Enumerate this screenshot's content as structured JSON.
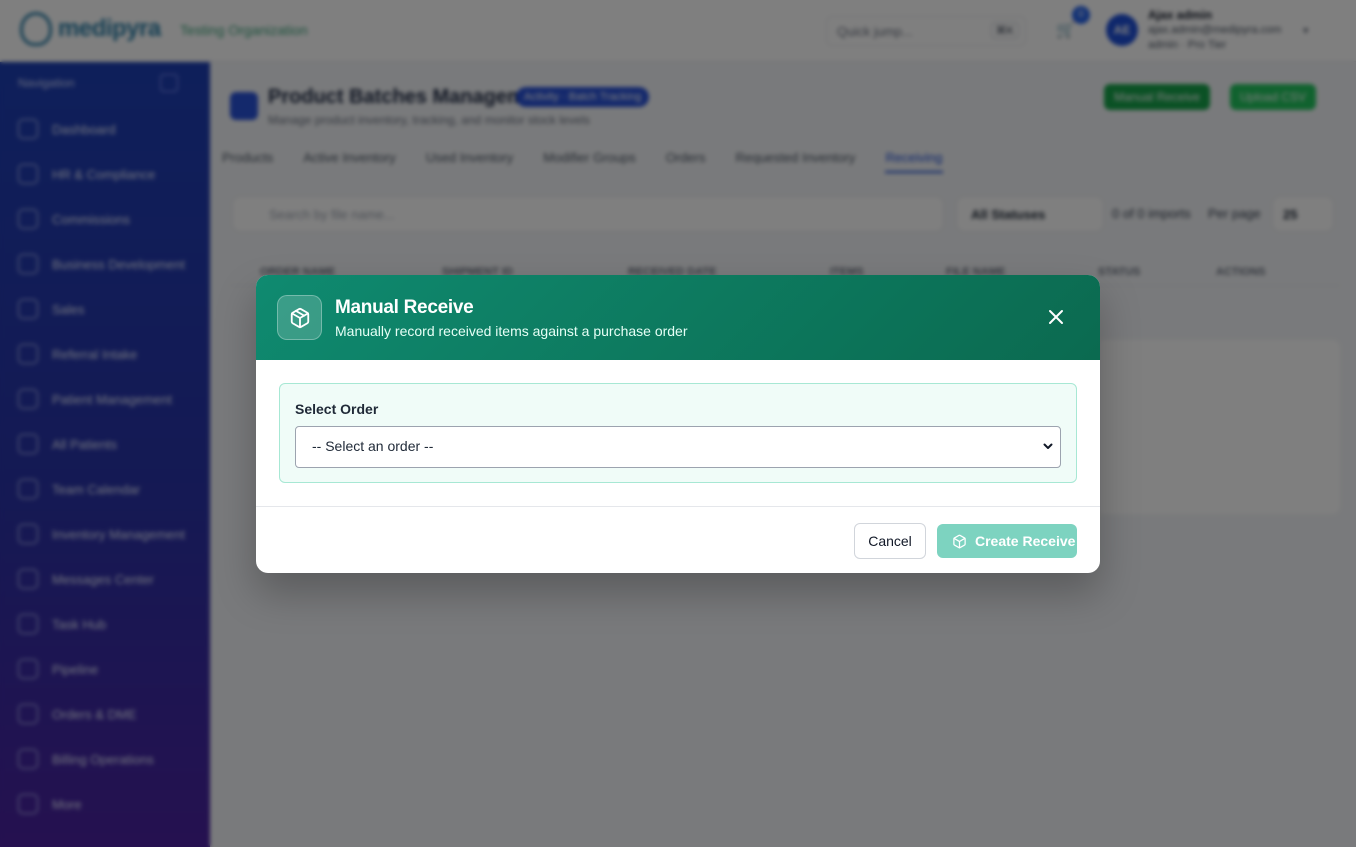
{
  "topbar": {
    "logo_text": "medipyra",
    "org_name": "Testing Organization",
    "search_placeholder": "Quick jump...",
    "search_shortcut": "⌘K",
    "cart_count": "0",
    "user_initials": "AE",
    "user_name": "Ajax admin",
    "user_email": "ajax.admin@medipyra.com",
    "user_role": "admin · Pro Tier"
  },
  "sidebar": {
    "heading": "Navigation",
    "items": [
      {
        "label": "Dashboard"
      },
      {
        "label": "HR & Compliance"
      },
      {
        "label": "Commissions"
      },
      {
        "label": "Business Development"
      },
      {
        "label": "Sales"
      },
      {
        "label": "Referral Intake"
      },
      {
        "label": "Patient Management"
      },
      {
        "label": "All Patients"
      },
      {
        "label": "Team Calendar"
      },
      {
        "label": "Inventory Management"
      },
      {
        "label": "Messages Center"
      },
      {
        "label": "Task Hub"
      },
      {
        "label": "Pipeline"
      },
      {
        "label": "Orders & DME"
      },
      {
        "label": "Billing Operations"
      },
      {
        "label": "More"
      }
    ]
  },
  "page": {
    "title": "Product Batches Management",
    "badge": "Activity · Batch Tracking",
    "subtitle": "Manage product inventory, tracking, and monitor stock levels",
    "btn_manual_receive": "Manual Receive",
    "btn_upload": "Upload CSV",
    "tabs": [
      "Products",
      "Active Inventory",
      "Used Inventory",
      "Modifier Groups",
      "Orders",
      "Requested Inventory",
      "Receiving"
    ],
    "active_tab": "Receiving",
    "search_placeholder": "Search by file name...",
    "filter_value": "All Statuses",
    "count_text": "0 of 0 imports",
    "per_page_label": "Per page",
    "per_page_value": "25",
    "columns": [
      "Order Name",
      "Shipment ID",
      "Received Date",
      "Items",
      "File Name",
      "Status",
      "Actions"
    ]
  },
  "modal": {
    "title": "Manual Receive",
    "subtitle": "Manually record received items against a purchase order",
    "select_label": "Select Order",
    "select_value": "-- Select an order --",
    "cancel_label": "Cancel",
    "create_label": "Create Receive"
  },
  "colors": {
    "modal_header": "#0d7a5f",
    "create_button_disabled": "#7dd3c0",
    "sidebar": "#2a33a8"
  }
}
